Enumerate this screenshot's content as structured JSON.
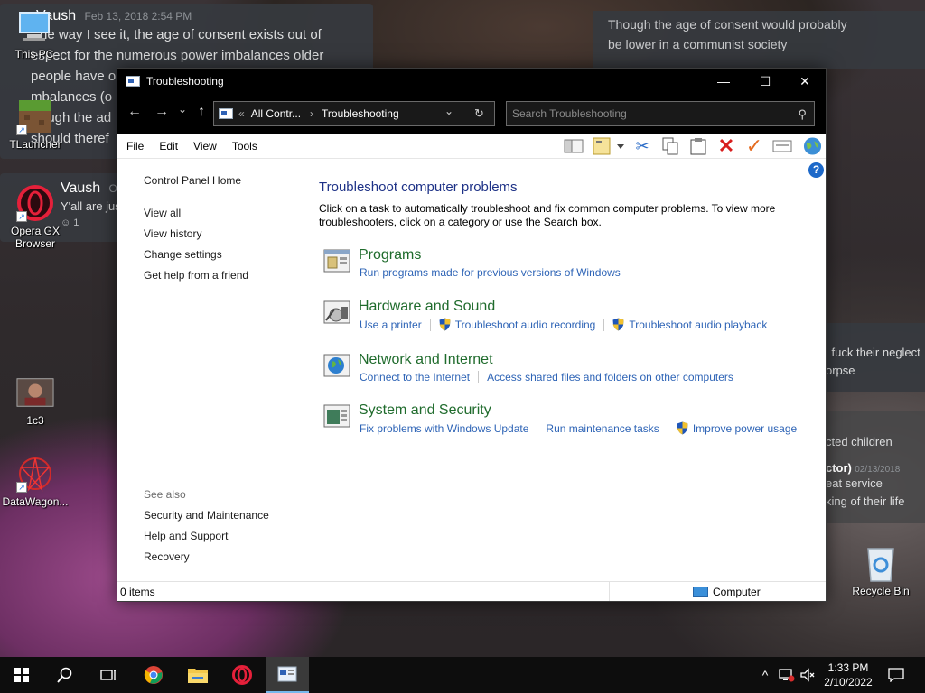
{
  "desktop": {
    "chat_left": {
      "author": "Vaush",
      "timestamp": "Feb 13, 2018 2:54 PM",
      "lines": [
        "he way I see it, the age of consent exists out of",
        "espect for the numerous power imbalances older",
        "people have o",
        "mbalances (o",
        "ough the ad",
        "should theref"
      ]
    },
    "chat_left2": {
      "author": "Vaush",
      "author_suffix": "Oc",
      "line": "Y'all are jus",
      "reaction": "1"
    },
    "chat_right": {
      "lines": [
        "Though the age of consent would probably",
        "be lower in a communist society"
      ]
    },
    "chat_right_mid": {
      "lines": [
        "l fuck their neglect",
        "orpse"
      ]
    },
    "chat_right_low": {
      "lines": [
        "cted children"
      ],
      "author": "ctor)",
      "timestamp": "02/13/2018",
      "sub_lines": [
        "eat service",
        "king of their life"
      ]
    },
    "icons": [
      {
        "label": "This PC"
      },
      {
        "label": "TLauncher"
      },
      {
        "label": "Opera GX Browser"
      },
      {
        "label": "1c3"
      },
      {
        "label": "DataWagon..."
      },
      {
        "label": "Recycle Bin"
      }
    ]
  },
  "window": {
    "title": "Troubleshooting",
    "controls": {
      "minimize": "—",
      "maximize": "☐",
      "close": "✕"
    },
    "address": {
      "prefix": "«",
      "crumb_root": "All Contr...",
      "crumb_sep": "›",
      "crumb_current": "Troubleshooting",
      "dropdown": "⌄",
      "refresh": "↻"
    },
    "search": {
      "placeholder": "Search Troubleshooting"
    },
    "nav": {
      "back": "←",
      "forward": "→",
      "recent": "⌄",
      "up": "↑"
    },
    "menu": [
      "File",
      "Edit",
      "View",
      "Tools"
    ],
    "help": "?",
    "left_pane": {
      "home": "Control Panel Home",
      "links": [
        "View all",
        "View history",
        "Change settings",
        "Get help from a friend"
      ],
      "see_also_title": "See also",
      "see_also": [
        "Security and Maintenance",
        "Help and Support",
        "Recovery"
      ]
    },
    "main": {
      "heading": "Troubleshoot computer problems",
      "intro": "Click on a task to automatically troubleshoot and fix common computer problems. To view more troubleshooters, click on a category or use the Search box.",
      "categories": [
        {
          "title": "Programs",
          "links": [
            {
              "label": "Run programs made for previous versions of Windows",
              "shield": false
            }
          ]
        },
        {
          "title": "Hardware and Sound",
          "links": [
            {
              "label": "Use a printer",
              "shield": false
            },
            {
              "label": "Troubleshoot audio recording",
              "shield": true
            },
            {
              "label": "Troubleshoot audio playback",
              "shield": true
            }
          ]
        },
        {
          "title": "Network and Internet",
          "links": [
            {
              "label": "Connect to the Internet",
              "shield": false
            },
            {
              "label": "Access shared files and folders on other computers",
              "shield": false
            }
          ]
        },
        {
          "title": "System and Security",
          "links": [
            {
              "label": "Fix problems with Windows Update",
              "shield": false
            },
            {
              "label": "Run maintenance tasks",
              "shield": false
            },
            {
              "label": "Improve power usage",
              "shield": true
            }
          ]
        }
      ]
    },
    "status": {
      "items": "0 items",
      "location": "Computer"
    }
  },
  "taskbar": {
    "clock_time": "1:33 PM",
    "clock_date": "2/10/2022",
    "tray_chevron": "^"
  },
  "colors": {
    "link_blue": "#2e64b6",
    "category_green": "#1f6b2c",
    "heading_blue": "#1e3287",
    "taskbar": "#0d0d0d"
  }
}
